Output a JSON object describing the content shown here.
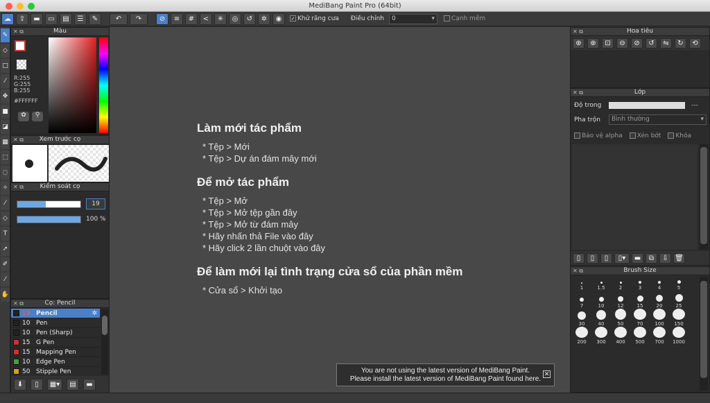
{
  "window": {
    "title": "MediBang Paint Pro (64bit)"
  },
  "toolbar": {
    "antialias_label": "Khử răng cưa",
    "correction_label": "Điều chỉnh",
    "correction_value": "0",
    "soft_edge_label": "Cạnh mềm"
  },
  "color_panel": {
    "title": "Màu",
    "r": "R:255",
    "g": "G:255",
    "b": "B:255",
    "hex": "#FFFFFF"
  },
  "brush_preview": {
    "title": "Xem trước cọ"
  },
  "brush_control": {
    "title": "Kiểm soát cọ",
    "size_value": "19",
    "opacity_value": "100 %",
    "size_fraction": 0.45,
    "opacity_fraction": 1.0
  },
  "brush_list": {
    "title": "Cọ: Pencil",
    "items": [
      {
        "size": "19",
        "name": "Pencil",
        "color": "#222222",
        "selected": true
      },
      {
        "size": "10",
        "name": "Pen",
        "color": "#222222"
      },
      {
        "size": "10",
        "name": "Pen (Sharp)",
        "color": "#222222"
      },
      {
        "size": "15",
        "name": "G Pen",
        "color": "#d03030"
      },
      {
        "size": "15",
        "name": "Mapping Pen",
        "color": "#d03030"
      },
      {
        "size": "10",
        "name": "Edge Pen",
        "color": "#40a040"
      },
      {
        "size": "50",
        "name": "Stipple Pen",
        "color": "#d0a020"
      }
    ]
  },
  "canvas_hint": {
    "new_title": "Làm mới tác phẩm",
    "new_lines": [
      "* Tệp > Mới",
      "* Tệp > Dự án đám mây mới"
    ],
    "open_title": "Để mở tác phẩm",
    "open_lines": [
      "* Tệp > Mở",
      "* Tệp > Mở tệp gần đây",
      "* Tệp > Mở từ đám mây",
      "* Hãy nhấn thả File vào đây",
      "* Hãy click 2 lần chuột vào đây"
    ],
    "reset_title": "Để làm mới lại tình trạng cửa sổ của phần mềm",
    "reset_lines": [
      "* Cửa sổ > Khởi tạo"
    ]
  },
  "notice": {
    "line1": "You are not using the latest version of MediBang Paint.",
    "line2": "Please install the latest version of MediBang Paint found here.",
    "close": "✕"
  },
  "navigator": {
    "title": "Hoa tiêu"
  },
  "layer_panel": {
    "title": "Lớp",
    "opacity_label": "Độ trong",
    "opacity_value": "---",
    "blend_label": "Pha trộn",
    "blend_value": "Bình thường",
    "protect_alpha": "Bảo vệ alpha",
    "clipping": "Xén bớt",
    "lock": "Khóa"
  },
  "brush_size": {
    "title": "Brush Size",
    "sizes": [
      "1",
      "1.5",
      "2",
      "3",
      "4",
      "5",
      "7",
      "10",
      "12",
      "15",
      "20",
      "25",
      "30",
      "40",
      "50",
      "70",
      "100",
      "150",
      "200",
      "300",
      "400",
      "500",
      "700",
      "1000"
    ]
  }
}
